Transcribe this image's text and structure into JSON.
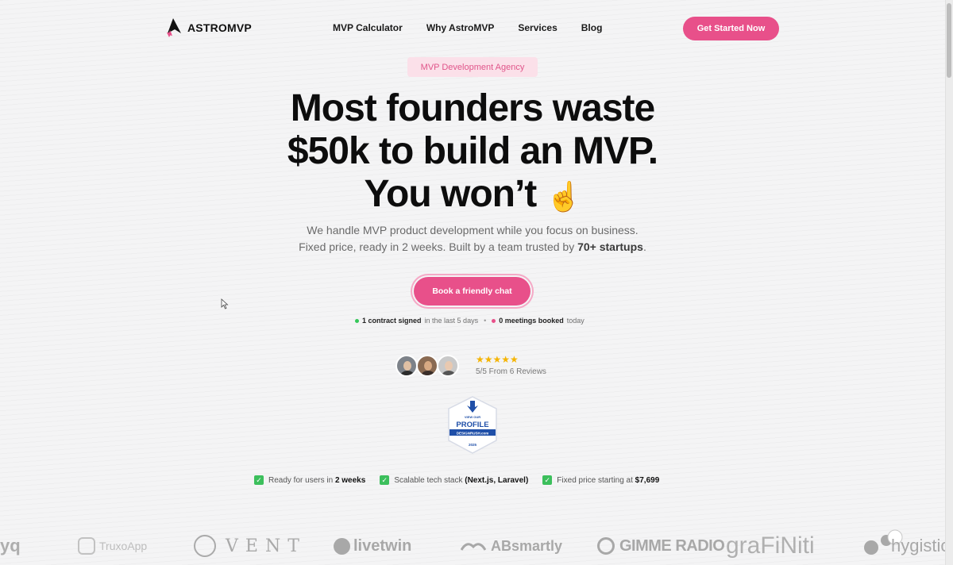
{
  "header": {
    "logo_text": "ASTROMVP",
    "nav": [
      "MVP Calculator",
      "Why AstroMVP",
      "Services",
      "Blog"
    ],
    "cta": "Get Started Now"
  },
  "hero": {
    "badge": "MVP Development Agency",
    "headline_line1": "Most founders waste",
    "headline_line2": "$50k to build an MVP.",
    "headline_line3": "You won’t",
    "headline_emoji": "☝️",
    "subtext_line1": "We handle MVP product development while you focus on business.",
    "subtext_line2_pre": "Fixed price, ready in 2 weeks. Built by a team trusted by ",
    "subtext_line2_bold": "70+ startups",
    "subtext_line2_post": ".",
    "button": "Book a friendly chat"
  },
  "status": {
    "contracts_bold": "1 contract signed",
    "contracts_rest": "in the last 5 days",
    "meetings_bold": "0 meetings booked",
    "meetings_rest": "today"
  },
  "reviews": {
    "stars": "★★★★★",
    "text": "5/5 From 6 Reviews",
    "rating_value": 5,
    "rating_max": 5
  },
  "design_badge": {
    "line1": "VIEW OUR",
    "line2": "PROFILE",
    "line3": "DESIGNRUSH.com",
    "year": "2025"
  },
  "features": [
    {
      "pre": "Ready for users in ",
      "bold": "2 weeks"
    },
    {
      "pre": "Scalable tech stack ",
      "bold": "(Next.js, Laravel)"
    },
    {
      "pre": "Fixed price starting at ",
      "bold": "$7,699"
    }
  ],
  "logos": [
    "yq",
    "TruxoApp",
    "VENT",
    "livetwin",
    "ABsmartly",
    "GIMME RADIO",
    "graFiNiti",
    "hygistic"
  ],
  "colors": {
    "accent": "#e8508a",
    "badge_bg": "#fbe0e9",
    "check": "#3cbf5c",
    "star": "#f5b400"
  }
}
